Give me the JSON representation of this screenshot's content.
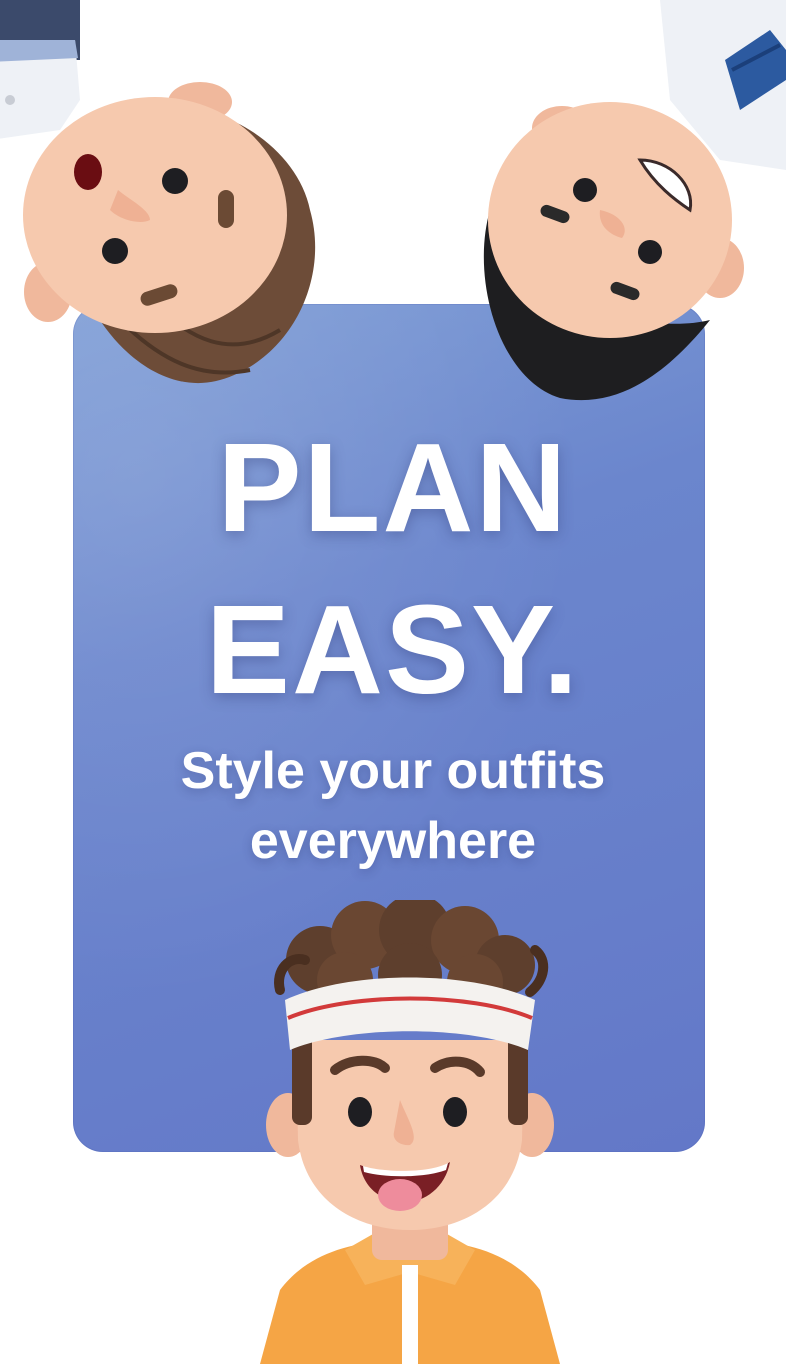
{
  "promo": {
    "headline_line1": "PLAN",
    "headline_line2": "EASY.",
    "subtitle_line1": "Style your outfits",
    "subtitle_line2": "everywhere"
  },
  "colors": {
    "card": "#6b86cd",
    "text": "#ffffff",
    "skin": "#f5c7ad",
    "hair_brown": "#6a4a36",
    "hair_black": "#1c1c1e",
    "headband_red": "#d23a3a",
    "jacket_orange": "#f5a545"
  },
  "icons": {
    "avatar_left": "woman-avatar-upside-down",
    "avatar_right": "man-avatar-upside-down",
    "avatar_bottom": "curly-hair-avatar"
  }
}
